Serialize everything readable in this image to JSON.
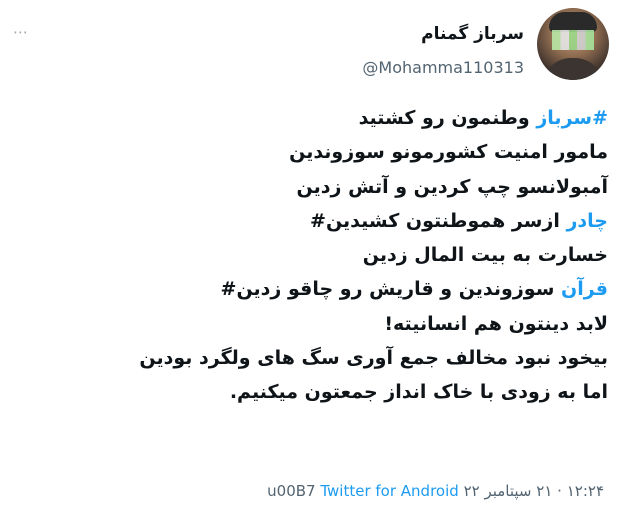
{
  "more_glyph": "⋯",
  "user": {
    "display_name": "سرباز گمنام",
    "handle": "@Mohamma110313"
  },
  "tweet": {
    "lines": [
      {
        "hashtag": "#سرباز",
        "text": " وطنمون رو کشتید"
      },
      {
        "hashtag": "",
        "text": "مامور امنیت کشورمونو سوزوندین"
      },
      {
        "hashtag": "",
        "text": "آمبولانسو چپ کردین و آتش زدین"
      },
      {
        "hashtag": "چادر",
        "text": " ازسر هموطنتون کشیدین#"
      },
      {
        "hashtag": "",
        "text": "خسارت به بیت المال زدین"
      },
      {
        "hashtag": "قرآن",
        "text": " سوزوندین و قاریش رو چاقو زدین#"
      },
      {
        "hashtag": "",
        "text": "لابد دینتون هم انسانیته!"
      },
      {
        "hashtag": "",
        "text": "بیخود نبود مخالف جمع آوری سگ های ولگرد بودین"
      },
      {
        "hashtag": "",
        "text": "اما به زودی با خاک انداز جمعتون میکنیم."
      }
    ]
  },
  "meta": {
    "timestamp": "۱۲:۲۴ · ۲۱ سپتامبر ۲۲",
    "separator": " u00B7 ",
    "source": "Twitter for Android"
  },
  "colors": {
    "link": "#1d9bf0",
    "secondary": "#536471",
    "text": "#0f1419"
  }
}
